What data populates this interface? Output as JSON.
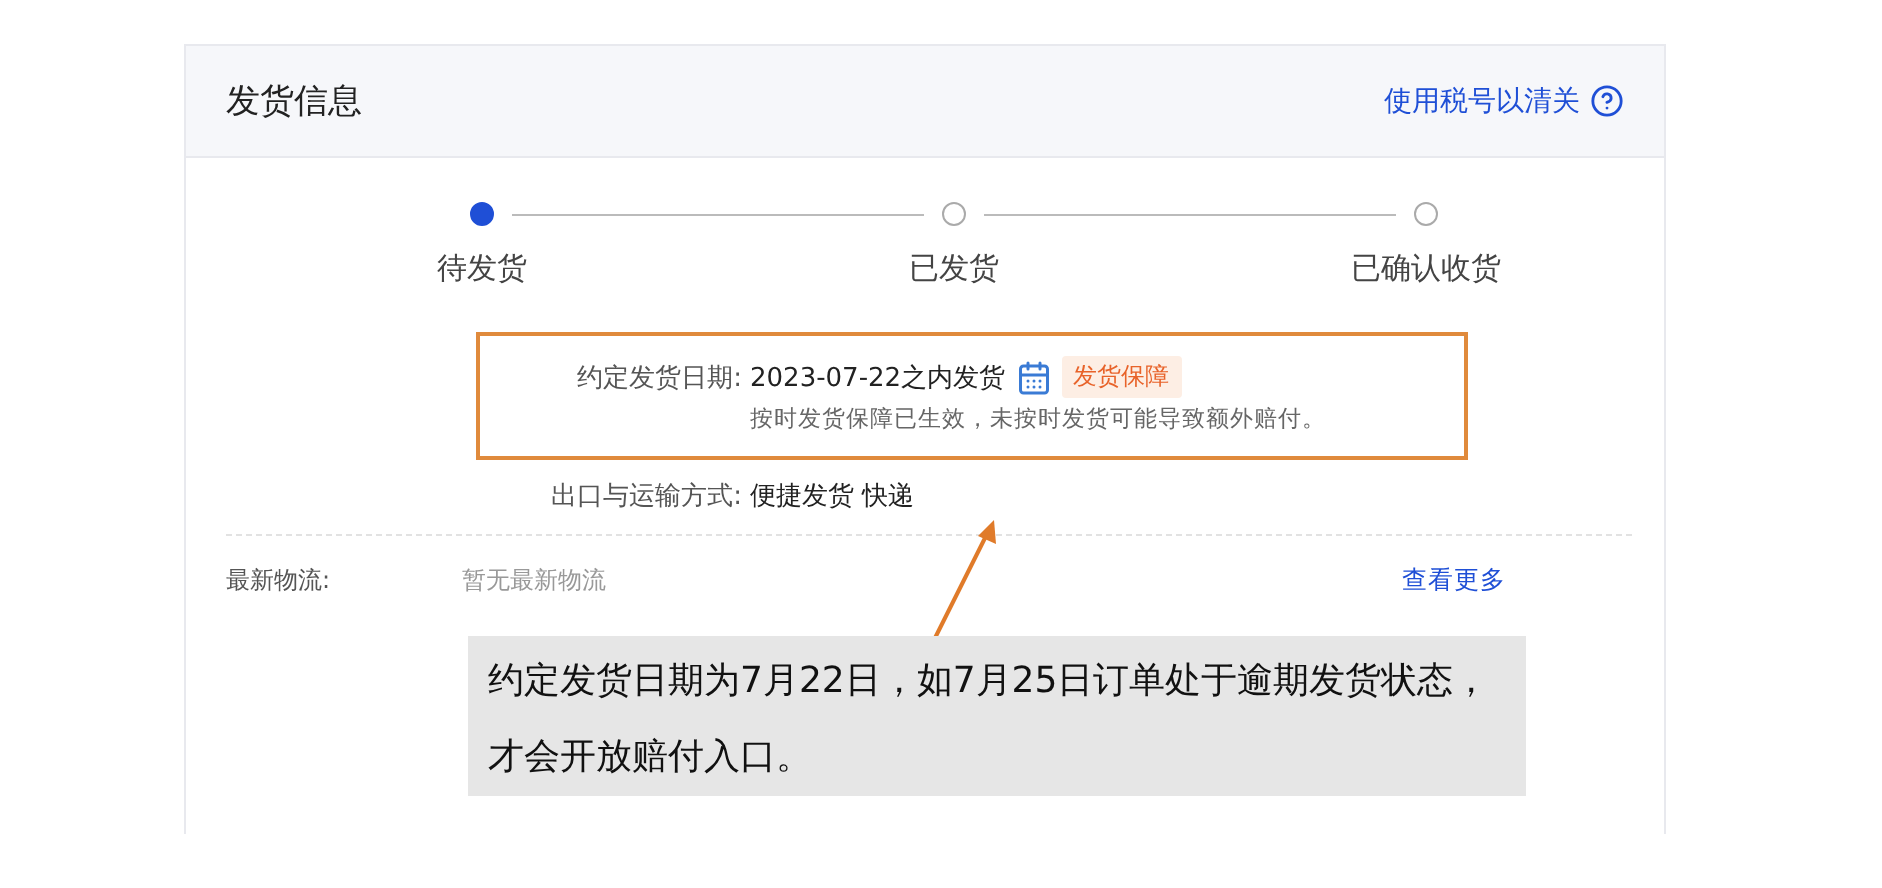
{
  "section": {
    "title": "发货信息",
    "link": "使用税号以清关"
  },
  "steps": [
    {
      "label": "待发货",
      "selected": true
    },
    {
      "label": "已发货",
      "selected": false
    },
    {
      "label": "已确认收货",
      "selected": false
    }
  ],
  "delivery_date": {
    "label": "约定发货日期:",
    "value": "2023-07-22之内发货",
    "badge": "发货保障",
    "note": "按时发货保障已生效，未按时发货可能导致额外赔付。"
  },
  "shipping_method": {
    "label": "出口与运输方式:",
    "value": "便捷发货 快递"
  },
  "logistics": {
    "label": "最新物流:",
    "value": "暂无最新物流",
    "link": "查看更多"
  },
  "annotation": {
    "text": "约定发货日期为7月22日，如7月25日订单处于逾期发货状态，才会开放赔付入口。"
  }
}
